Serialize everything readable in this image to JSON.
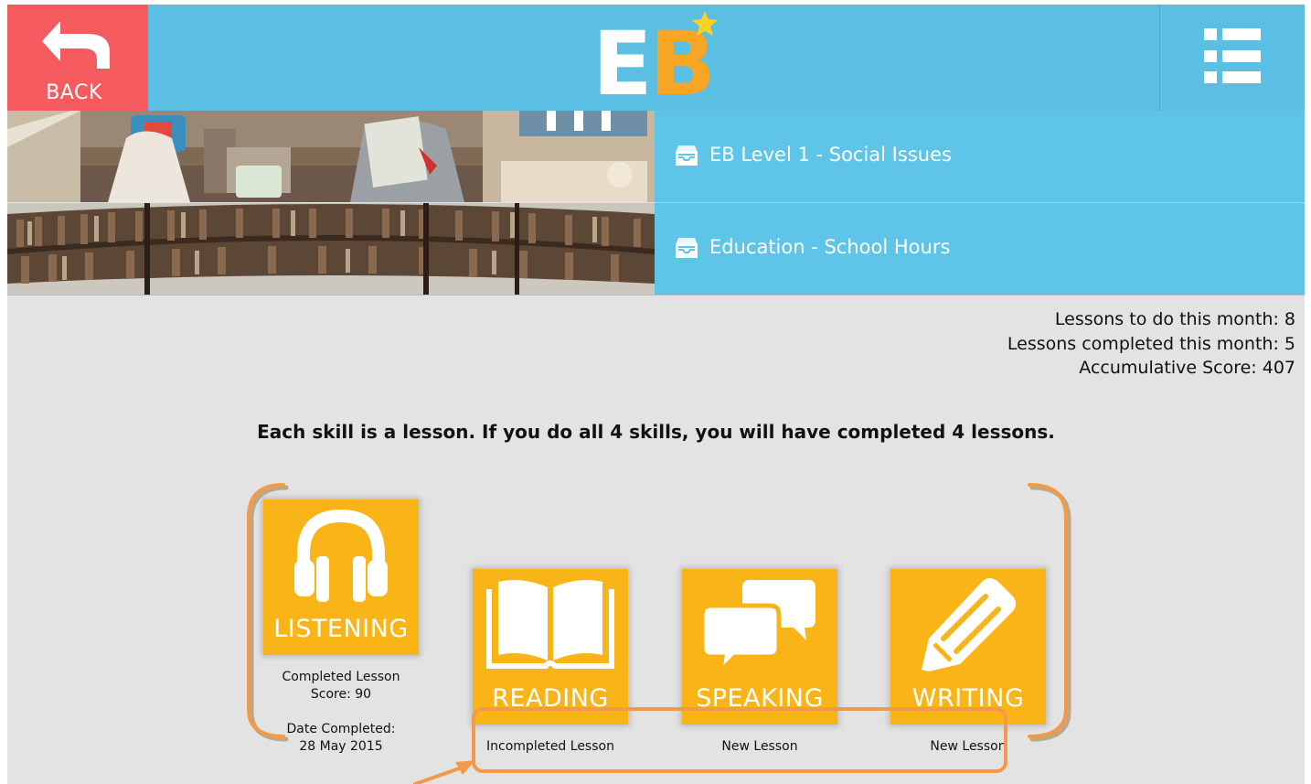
{
  "header": {
    "back_label": "BACK",
    "logo_letters": {
      "e": "E",
      "b": "B"
    },
    "colors": {
      "bar": "#5bbfe4",
      "back": "#f45a5e",
      "logo_orange": "#f6a623",
      "star": "#fbd21f"
    },
    "icons": {
      "back": "back-arrow-icon",
      "menu": "list-menu-icon"
    }
  },
  "lessons": [
    {
      "title": "EB Level 1 - Social Issues",
      "icon": "inbox-tray-icon"
    },
    {
      "title": "Education - School Hours",
      "icon": "inbox-tray-icon"
    }
  ],
  "stats": {
    "to_do": "Lessons to do this month: 8",
    "completed": "Lessons completed this month: 5",
    "score": "Accumulative Score: 407"
  },
  "instruction": "Each skill is a lesson. If you do all 4 skills, you will have completed 4 lessons.",
  "skills": [
    {
      "label": "LISTENING",
      "icon": "headphones-icon",
      "status": "Completed Lesson",
      "score": "Score: 90",
      "date_label": "Date Completed:",
      "date": "28 May 2015"
    },
    {
      "label": "READING",
      "icon": "open-book-icon",
      "status": "Incompleted Lesson"
    },
    {
      "label": "SPEAKING",
      "icon": "speech-bubbles-icon",
      "status": "New Lesson"
    },
    {
      "label": "WRITING",
      "icon": "pencil-icon",
      "status": "New Lesson"
    }
  ],
  "colors": {
    "tile": "#f9b418",
    "annotation": "#f39a4a",
    "row_info": "#5ec4e8",
    "background": "#e3e3e3"
  }
}
